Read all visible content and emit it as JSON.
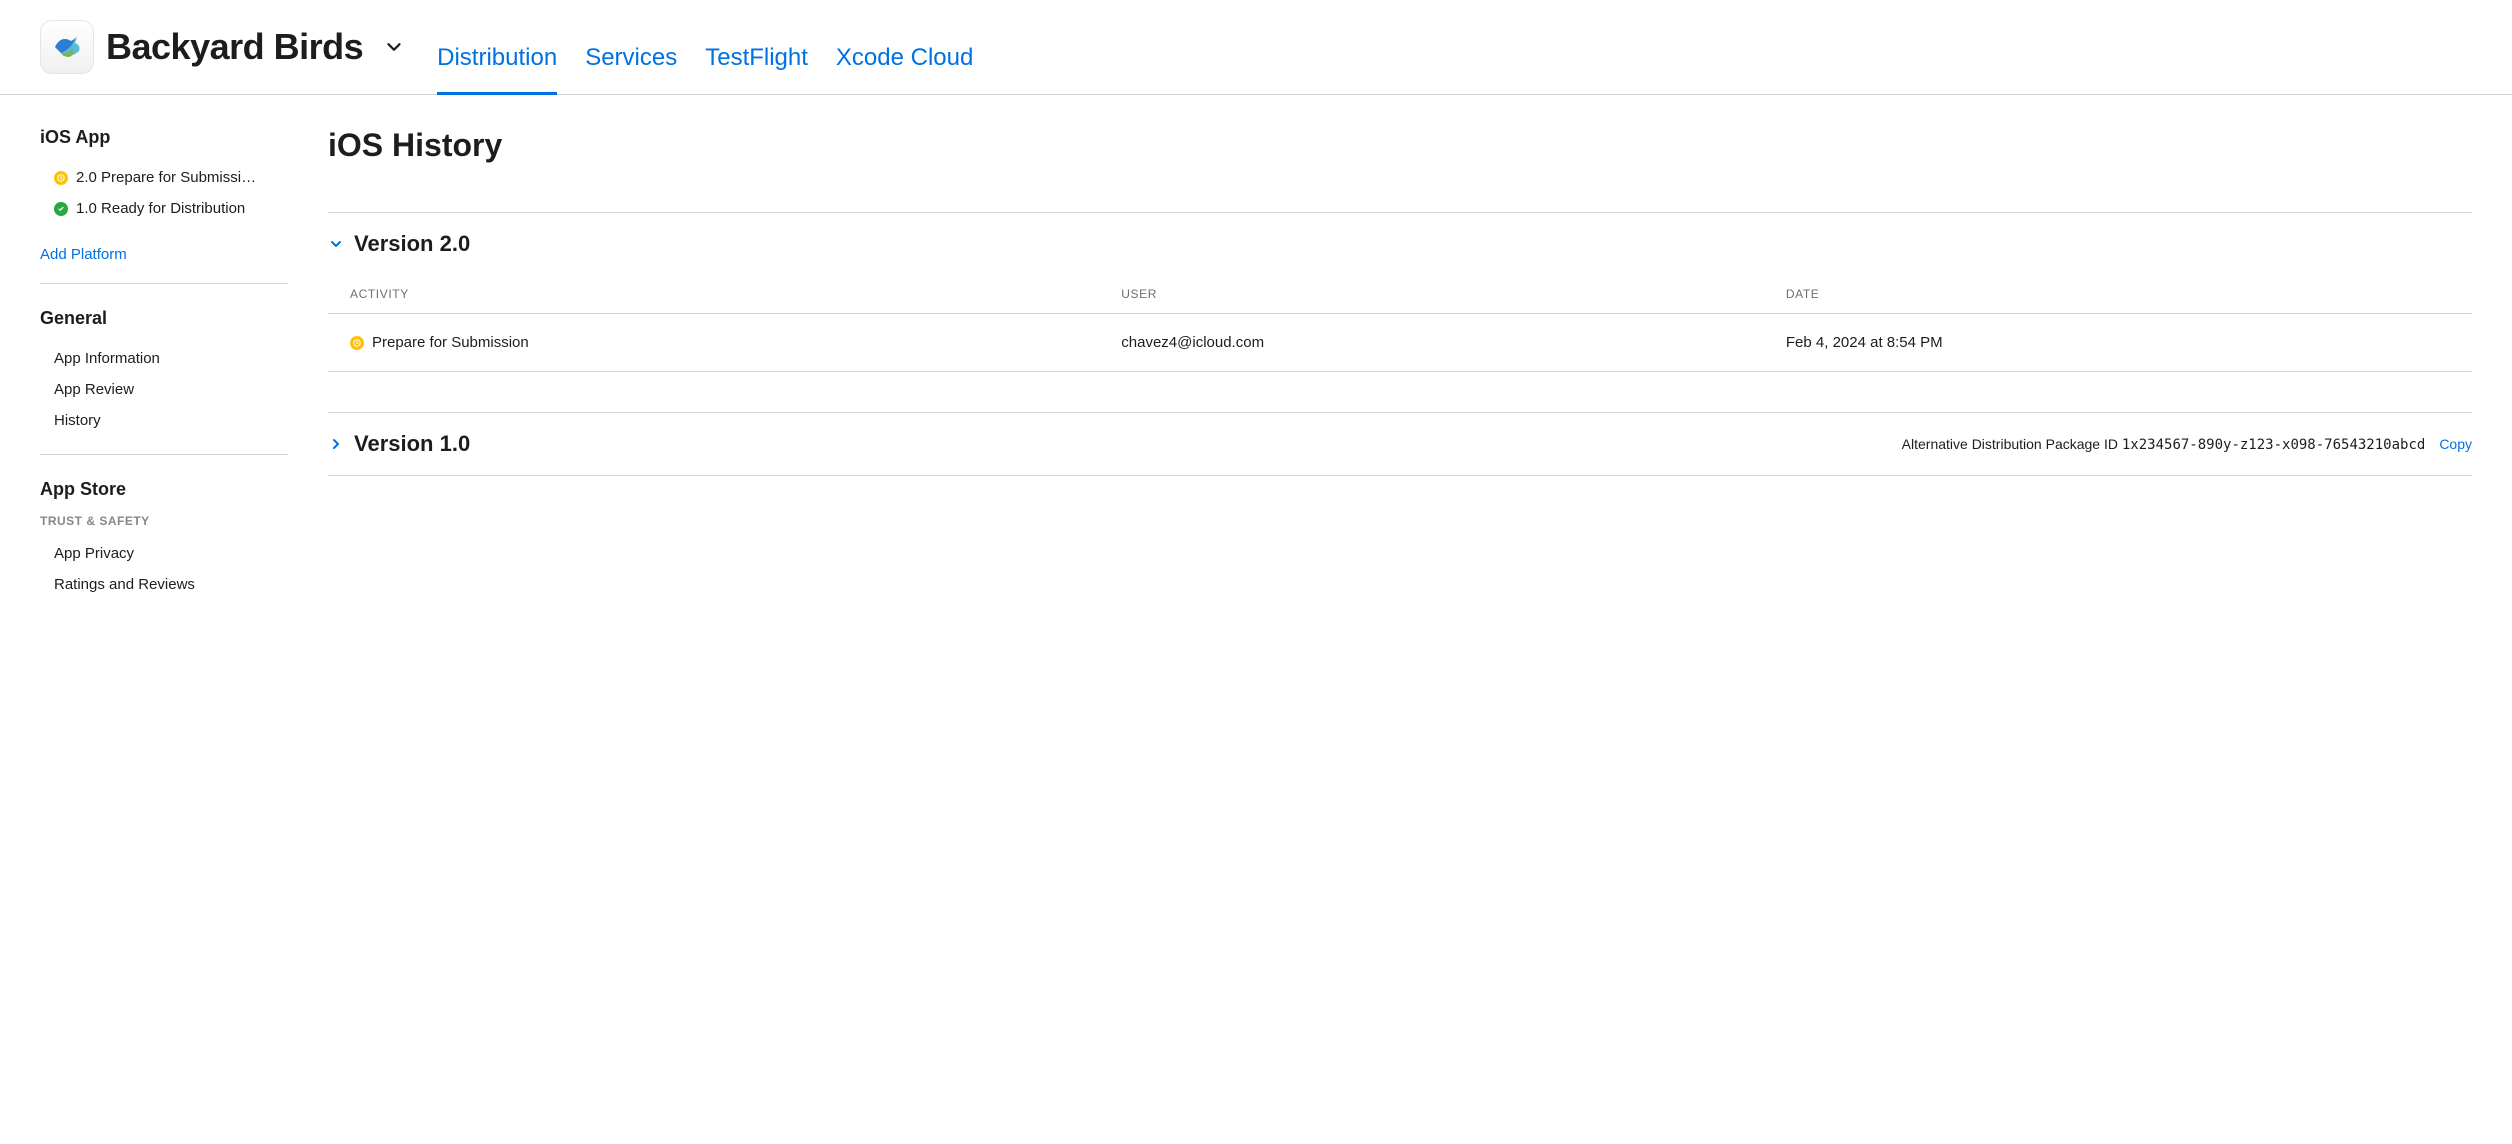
{
  "header": {
    "app_name": "Backyard Birds",
    "tabs": [
      {
        "label": "Distribution",
        "active": true
      },
      {
        "label": "Services",
        "active": false
      },
      {
        "label": "TestFlight",
        "active": false
      },
      {
        "label": "Xcode Cloud",
        "active": false
      }
    ]
  },
  "sidebar": {
    "ios_app": {
      "title": "iOS App",
      "items": [
        {
          "status": "yellow",
          "label": "2.0 Prepare for Submissi…"
        },
        {
          "status": "green",
          "label": "1.0 Ready for Distribution"
        }
      ],
      "add_platform": "Add Platform"
    },
    "general": {
      "title": "General",
      "items": [
        {
          "label": "App Information"
        },
        {
          "label": "App Review"
        },
        {
          "label": "History"
        }
      ]
    },
    "app_store": {
      "title": "App Store",
      "subheader": "TRUST & SAFETY",
      "items": [
        {
          "label": "App Privacy"
        },
        {
          "label": "Ratings and Reviews"
        }
      ]
    }
  },
  "main": {
    "page_title": "iOS History",
    "versions": [
      {
        "title": "Version 2.0",
        "expanded": true,
        "table": {
          "headers": {
            "activity": "ACTIVITY",
            "user": "USER",
            "date": "DATE"
          },
          "rows": [
            {
              "status": "yellow",
              "activity": "Prepare for Submission",
              "user": "chavez4@icloud.com",
              "date": "Feb 4, 2024 at 8:54 PM"
            }
          ]
        }
      },
      {
        "title": "Version 1.0",
        "expanded": false,
        "package_id_label": "Alternative Distribution Package ID",
        "package_id": "1x234567-890y-z123-x098-76543210abcd",
        "copy_label": "Copy"
      }
    ]
  }
}
